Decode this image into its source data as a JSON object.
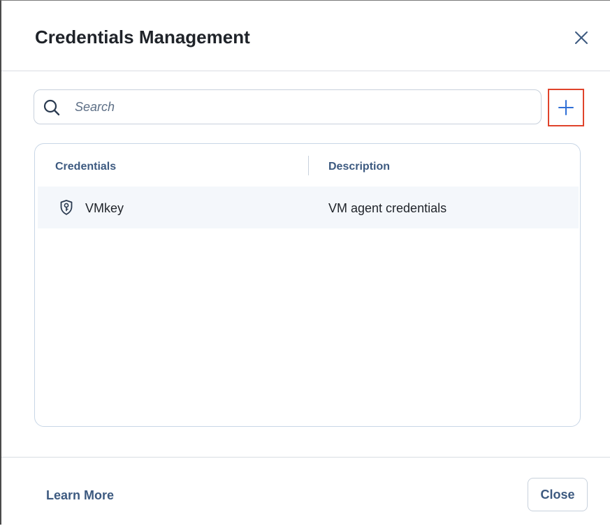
{
  "dialog": {
    "title": "Credentials Management"
  },
  "search": {
    "placeholder": "Search",
    "value": ""
  },
  "toolbar": {
    "add_icon": "plus-icon",
    "close_icon": "close-icon"
  },
  "table": {
    "columns": [
      "Credentials",
      "Description"
    ],
    "rows": [
      {
        "icon": "shield-key-icon",
        "name": "VMkey",
        "description": "VM agent credentials"
      }
    ]
  },
  "footer": {
    "learn_more_label": "Learn More",
    "close_label": "Close"
  },
  "colors": {
    "accent": "#3d5a80",
    "link_blue": "#2f6fd6",
    "highlight": "#e0432b"
  }
}
